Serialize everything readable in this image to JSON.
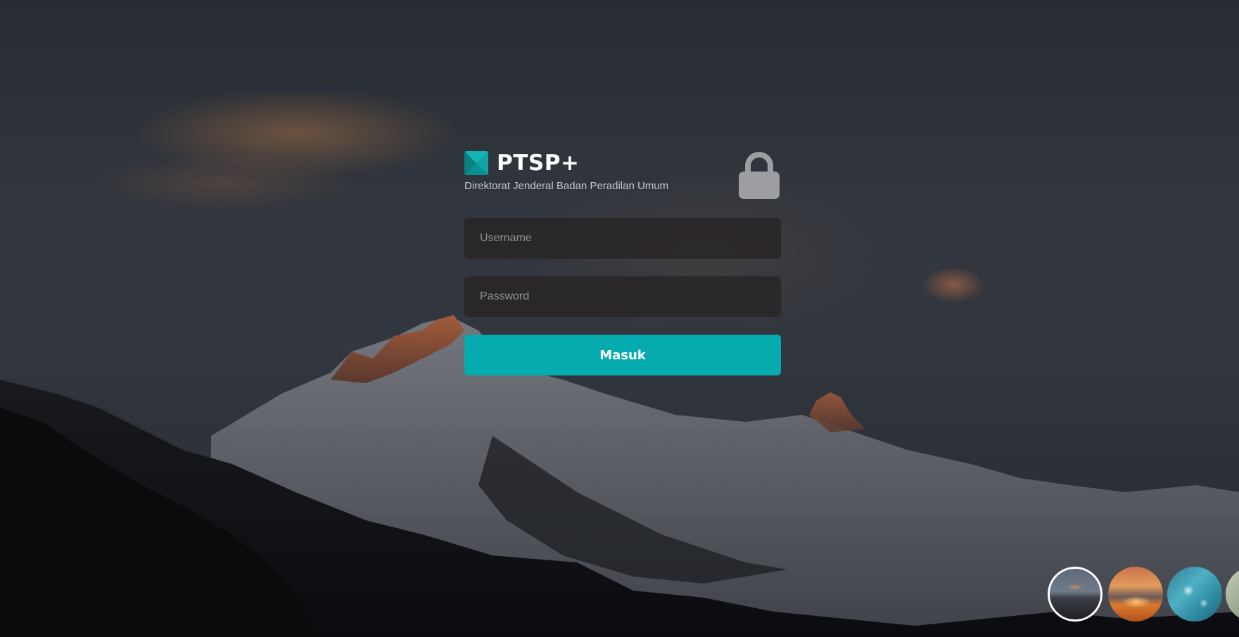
{
  "brand": {
    "name": "PTSP+",
    "subtitle": "Direktorat Jenderal Badan Peradilan Umum",
    "logo_icon": "ptsp-logo-icon",
    "accent_color": "#05abaf"
  },
  "form": {
    "username_placeholder": "Username",
    "password_placeholder": "Password",
    "submit_label": "Masuk",
    "lock_icon": "lock-icon"
  },
  "background_selector": {
    "options": [
      "mountain-sunset",
      "orange-sky",
      "ocean-aerial",
      "meadow"
    ],
    "selected": "mountain-sunset"
  }
}
